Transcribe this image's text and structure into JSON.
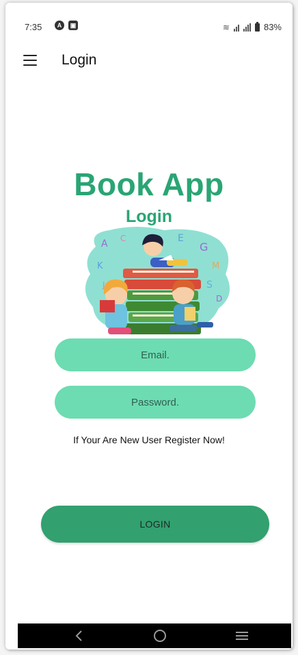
{
  "status_bar": {
    "time": "7:35",
    "battery": "83%"
  },
  "app_bar": {
    "title": "Login"
  },
  "hero": {
    "app_name": "Book App",
    "subtitle": "Login"
  },
  "form": {
    "email_placeholder": "Email.",
    "password_placeholder": "Password.",
    "register_link": "If Your Are New User Register Now!",
    "login_button": "LOGIN"
  },
  "colors": {
    "accent": "#2aa574",
    "field_bg": "#6ddcb2",
    "button_bg": "#32a06f",
    "nav_bar": "#000000"
  },
  "icons": [
    "menu-icon",
    "back-icon",
    "home-icon",
    "recents-icon"
  ]
}
